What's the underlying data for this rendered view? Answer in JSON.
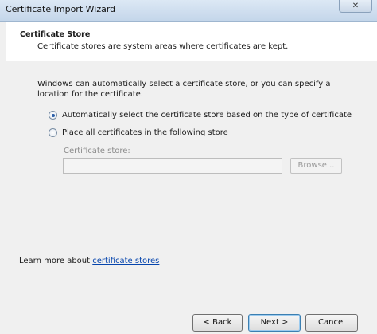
{
  "window": {
    "title": "Certificate Import Wizard",
    "close_glyph": "✕"
  },
  "header": {
    "section_title": "Certificate Store",
    "description": "Certificate stores are system areas where certificates are kept."
  },
  "content": {
    "intro": "Windows can automatically select a certificate store, or you can specify a location for the certificate.",
    "options": [
      {
        "label": "Automatically select the certificate store based on the type of certificate",
        "selected": true
      },
      {
        "label": "Place all certificates in the following store",
        "selected": false
      }
    ],
    "store_label": "Certificate store:",
    "store_value": "",
    "browse_label": "Browse..."
  },
  "learn_more": {
    "prefix": "Learn more about ",
    "link": "certificate stores"
  },
  "footer": {
    "back_label": "< Back",
    "next_label": "Next >",
    "cancel_label": "Cancel"
  }
}
